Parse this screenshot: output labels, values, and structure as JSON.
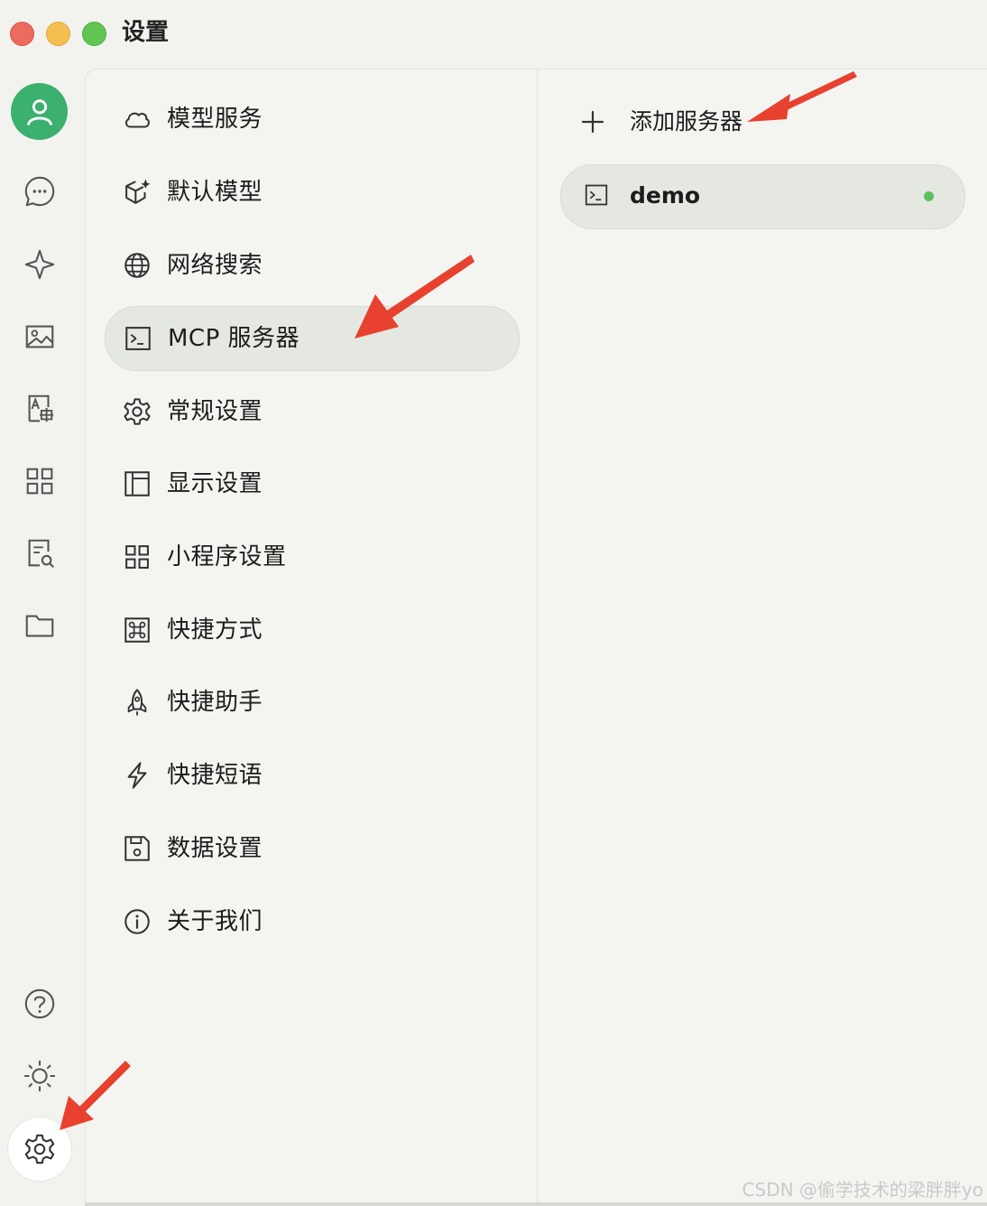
{
  "window": {
    "title": "设置"
  },
  "rail": {
    "items": [
      {
        "name": "assistant-chat",
        "icon": "chat-bubble-icon"
      },
      {
        "name": "agents",
        "icon": "sparkle-icon"
      },
      {
        "name": "painting",
        "icon": "image-icon"
      },
      {
        "name": "translate",
        "icon": "translate-icon"
      },
      {
        "name": "mini-apps",
        "icon": "apps-grid-icon"
      },
      {
        "name": "knowledge",
        "icon": "doc-search-icon"
      },
      {
        "name": "files",
        "icon": "folder-icon"
      }
    ],
    "bottom": [
      {
        "name": "help",
        "icon": "help-icon"
      },
      {
        "name": "theme",
        "icon": "sun-icon"
      },
      {
        "name": "settings",
        "icon": "gear-icon"
      }
    ]
  },
  "menu": {
    "items": [
      {
        "label": "模型服务",
        "icon": "cloud-icon"
      },
      {
        "label": "默认模型",
        "icon": "cube-sparkle-icon"
      },
      {
        "label": "网络搜索",
        "icon": "globe-icon"
      },
      {
        "label": "MCP 服务器",
        "icon": "terminal-icon",
        "active": true
      },
      {
        "label": "常规设置",
        "icon": "gear-icon"
      },
      {
        "label": "显示设置",
        "icon": "layout-icon"
      },
      {
        "label": "小程序设置",
        "icon": "apps-grid-icon"
      },
      {
        "label": "快捷方式",
        "icon": "command-icon"
      },
      {
        "label": "快捷助手",
        "icon": "rocket-icon"
      },
      {
        "label": "快捷短语",
        "icon": "bolt-icon"
      },
      {
        "label": "数据设置",
        "icon": "save-icon"
      },
      {
        "label": "关于我们",
        "icon": "info-icon"
      }
    ]
  },
  "mcp": {
    "add_label": "添加服务器",
    "servers": [
      {
        "name": "demo",
        "status_color": "#5cc05e"
      }
    ]
  },
  "colors": {
    "avatar_bg": "#3cb06f",
    "annotation_arrow": "#e8412f",
    "active_bg": "#e5e8e1"
  },
  "watermark": "CSDN @偷学技术的梁胖胖yo"
}
